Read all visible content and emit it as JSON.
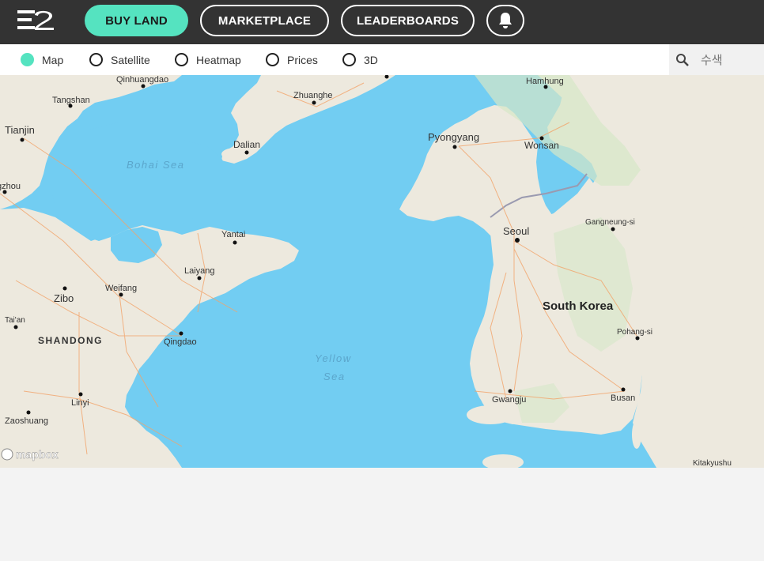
{
  "header": {
    "logo_icon": "e2-logo-icon",
    "buy_land_label": "BUY LAND",
    "marketplace_label": "MARKETPLACE",
    "leaderboards_label": "LEADERBOARDS",
    "bell_icon": "bell-icon",
    "accent_color": "#55e3c0",
    "bar_color": "#333333"
  },
  "view_options": {
    "selected": "Map",
    "items": [
      {
        "label": "Map"
      },
      {
        "label": "Satellite"
      },
      {
        "label": "Heatmap"
      },
      {
        "label": "Prices"
      },
      {
        "label": "3D"
      }
    ]
  },
  "search": {
    "placeholder": "수색",
    "icon": "search-icon"
  },
  "map": {
    "sea_color": "#72cdf2",
    "land_color": "#ede9de",
    "labels": {
      "qinhuangdao": "Qinhuangdao",
      "tangshan": "Tangshan",
      "tianjin": "Tianjin",
      "gzhou": "gzhou",
      "bohai_sea_1": "Bohai Sea",
      "zhuanghe": "Zhuanghe",
      "dalian": "Dalian",
      "hamhung": "Hamhung",
      "pyongyang": "Pyongyang",
      "wonsan": "Wonsan",
      "gangneung": "Gangneung-si",
      "seoul": "Seoul",
      "south_korea": "South Korea",
      "pohang": "Pohang-si",
      "yantai": "Yantai",
      "laiyang": "Laiyang",
      "weifang": "Weifang",
      "zibo": "Zibo",
      "taian": "Tai'an",
      "shandong": "SHANDONG",
      "qingdao": "Qingdao",
      "yellow_sea_1": "Yellow",
      "yellow_sea_2": "Sea",
      "linyi": "Linyi",
      "zaoshuang": "Zaoshuang",
      "gwangju": "Gwangju",
      "busan": "Busan",
      "kitakyushu": "Kitakyushu",
      "mapbox": "mapbox"
    }
  }
}
